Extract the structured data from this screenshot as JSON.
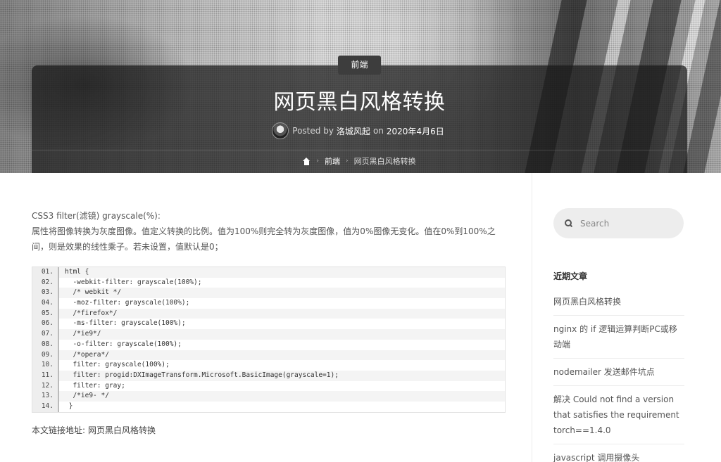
{
  "hero": {
    "category": "前端",
    "title": "网页黑白风格转换",
    "meta": {
      "posted_by_label": "Posted by",
      "author": "洛城风起",
      "on_label": "on",
      "date": "2020年4月6日"
    },
    "breadcrumb": {
      "items": [
        "前端",
        "网页黑白风格转换"
      ]
    }
  },
  "article": {
    "intro_line1": "CSS3 filter(滤镜) grayscale(%):",
    "intro_line2": "属性将图像转换为灰度图像。值定义转换的比例。值为100%则完全转为灰度图像，值为0%图像无变化。值在0%到100%之间，则是效果的线性乘子。若未设置，值默认是0；",
    "code": [
      {
        "ln": "01.",
        "src": "html {"
      },
      {
        "ln": "02.",
        "src": "  -webkit-filter: grayscale(100%);"
      },
      {
        "ln": "03.",
        "src": "  /* webkit */"
      },
      {
        "ln": "04.",
        "src": "  -moz-filter: grayscale(100%);"
      },
      {
        "ln": "05.",
        "src": "  /*firefox*/"
      },
      {
        "ln": "06.",
        "src": "  -ms-filter: grayscale(100%);"
      },
      {
        "ln": "07.",
        "src": "  /*ie9*/"
      },
      {
        "ln": "08.",
        "src": "  -o-filter: grayscale(100%);"
      },
      {
        "ln": "09.",
        "src": "  /*opera*/"
      },
      {
        "ln": "10.",
        "src": "  filter: grayscale(100%);"
      },
      {
        "ln": "11.",
        "src": "  filter: progid:DXImageTransform.Microsoft.BasicImage(grayscale=1);"
      },
      {
        "ln": "12.",
        "src": "  filter: gray;"
      },
      {
        "ln": "13.",
        "src": "  /*ie9- */"
      },
      {
        "ln": "14.",
        "src": " }"
      }
    ],
    "permalink_label": "本文链接地址:",
    "permalink_text": "网页黑白风格转换"
  },
  "sidebar": {
    "search_placeholder": "Search",
    "recent_heading": "近期文章",
    "recent_posts": [
      "网页黑白风格转换",
      "nginx 的 if 逻辑运算判断PC或移动端",
      "nodemailer 发送邮件坑点",
      "解决 Could not find a version that satisfies the requirement torch==1.4.0",
      "javascript 调用摄像头"
    ]
  }
}
